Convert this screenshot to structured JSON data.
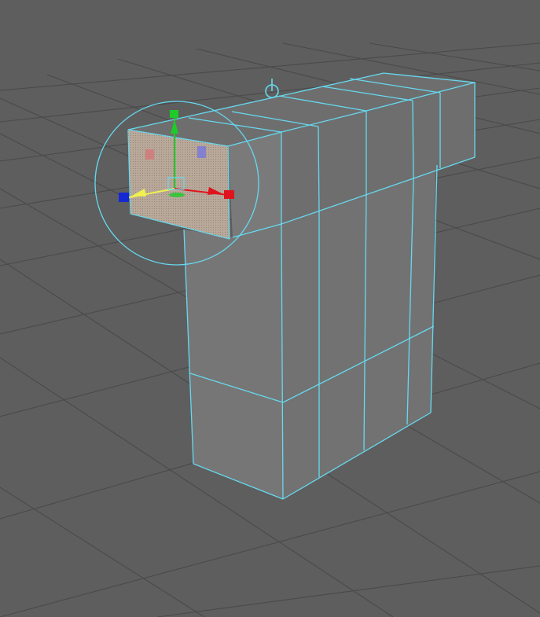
{
  "viewport": {
    "view": "perspective",
    "background_color": "#5e5e5e",
    "grid_color": "#4a4a4a",
    "wireframe_color": "#66d9f0",
    "selected_face_color": "#b9a99a"
  },
  "gizmo": {
    "tool": "move",
    "x_axis_color": "#e0141e",
    "y_axis_color": "#1ecb28",
    "z_axis_color": "#1428d6",
    "pivot_color": "#f0f050",
    "rotate_ring_color": "#66d9f0"
  },
  "mesh": {
    "shape": "l-shaped-block",
    "selection": "face",
    "face_color": "#767676"
  }
}
